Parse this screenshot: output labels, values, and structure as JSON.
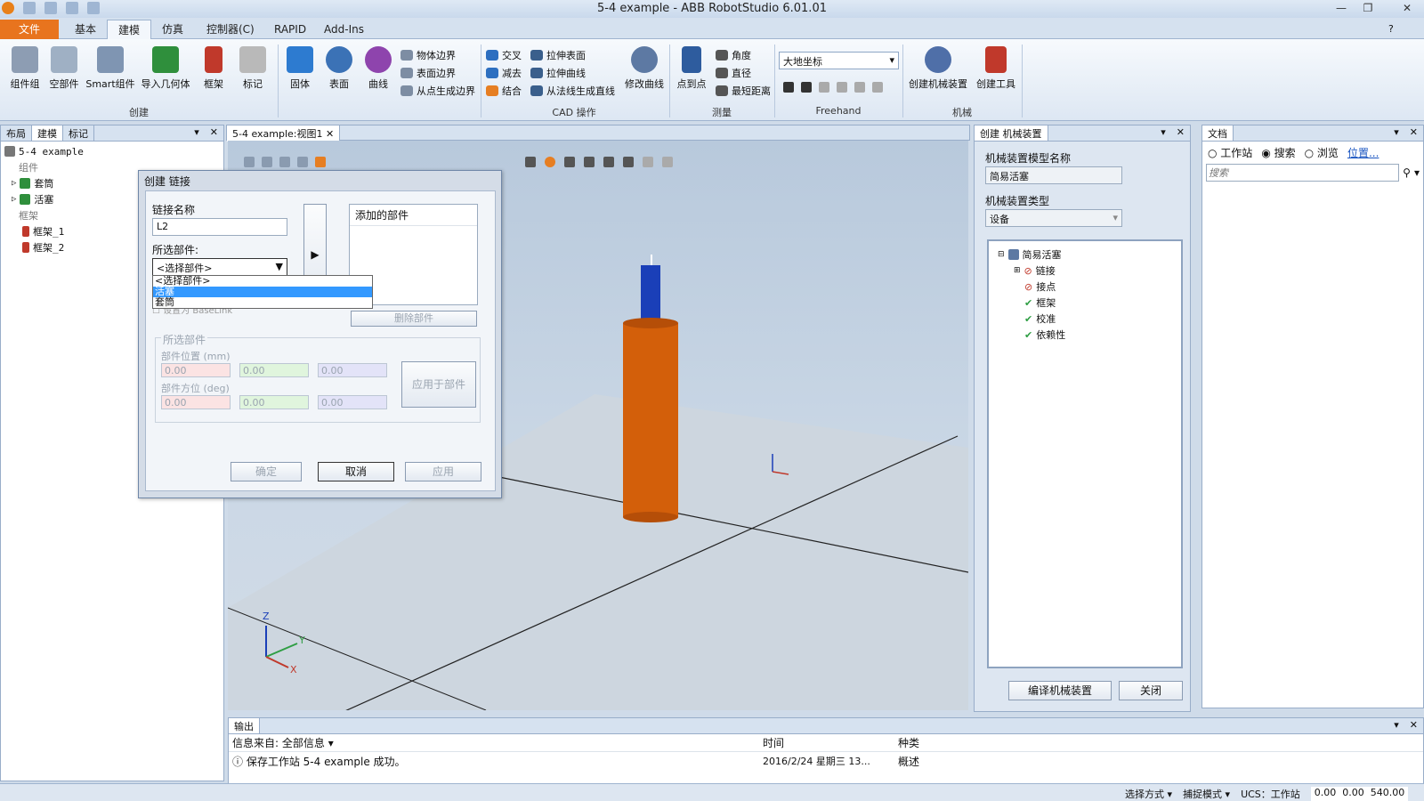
{
  "window": {
    "title": "5-4 example - ABB RobotStudio 6.01.01"
  },
  "ribbon_tabs": [
    "文件 (F)",
    "基本",
    "建模",
    "仿真",
    "控制器(C)",
    "RAPID",
    "Add-Ins"
  ],
  "ribbon": {
    "create": {
      "group": "创建",
      "buttons": [
        "组件组",
        "空部件",
        "Smart组件",
        "导入几何体",
        "框架",
        "标记"
      ]
    },
    "solids": {
      "buttons": [
        "固体",
        "表面",
        "曲线"
      ],
      "small": [
        "物体边界",
        "表面边界",
        "从点生成边界"
      ]
    },
    "cad": {
      "group": "CAD 操作",
      "small": [
        "交叉",
        "减去",
        "结合",
        "拉伸表面",
        "拉伸曲线",
        "从法线生成直线"
      ],
      "modify": "修改曲线"
    },
    "measure": {
      "group": "测量",
      "button": "点到点",
      "small": [
        "角度",
        "直径",
        "最短距离"
      ]
    },
    "freehand": {
      "group": "Freehand",
      "combo": "大地坐标"
    },
    "mechanism": {
      "group": "机械",
      "buttons": [
        "创建机械装置",
        "创建工具"
      ]
    }
  },
  "left_panel": {
    "tabs": [
      "布局",
      "建模",
      "标记"
    ],
    "root": "5-4 example",
    "components_header": "组件",
    "components": [
      "套筒",
      "活塞"
    ],
    "frames_header": "框架",
    "frames": [
      "框架_1",
      "框架_2"
    ]
  },
  "view": {
    "tab": "5-4 example:视图1"
  },
  "dialog": {
    "title": "创建 链接",
    "link_name_label": "链接名称",
    "link_name_value": "L2",
    "selected_part_label": "所选部件:",
    "selected_part_value": "<选择部件>",
    "dropdown_options": [
      "<选择部件>",
      "活塞",
      "套筒"
    ],
    "added_parts_header": "添加的部件",
    "baselink_label": "设置为 BaseLink",
    "remove_button": "删除部件",
    "section_label": "所选部件",
    "position_label": "部件位置 (mm)",
    "orientation_label": "部件方位 (deg)",
    "position_values": [
      "0.00",
      "0.00",
      "0.00"
    ],
    "orientation_values": [
      "0.00",
      "0.00",
      "0.00"
    ],
    "apply_to_part": "应用于部件",
    "ok": "确定",
    "cancel": "取消",
    "apply": "应用"
  },
  "mech_panel": {
    "title": "创建 机械装置",
    "model_name_label": "机械装置模型名称",
    "model_name_value": "简易活塞",
    "type_label": "机械装置类型",
    "type_value": "设备",
    "tree_root": "简易活塞",
    "tree_items": [
      "链接",
      "接点",
      "框架",
      "校准",
      "依赖性"
    ],
    "compile_button": "编译机械装置",
    "close_button": "关闭"
  },
  "doc_panel": {
    "title": "文档",
    "radios": [
      "工作站",
      "搜索",
      "浏览"
    ],
    "link": "位置...",
    "search_placeholder": "搜索"
  },
  "output": {
    "title": "输出",
    "filter": "信息来自: 全部信息",
    "col_time": "时间",
    "col_type": "种类",
    "message": "保存工作站 5-4 example 成功。",
    "time": "2016/2/24 星期三 13...",
    "type": "概述"
  },
  "status": {
    "select_mode": "选择方式",
    "snap_mode": "捕捉模式",
    "ucs": "UCS：工作站",
    "coords": [
      "0.00",
      "0.00",
      "540.00"
    ]
  },
  "axis_labels": {
    "z": "Z",
    "y": "Y",
    "x": "X"
  },
  "colors": {
    "file_tab": "#e8741e",
    "selection": "#3399ff",
    "sleeve": "#d35f0a",
    "piston": "#1a3fb8"
  }
}
